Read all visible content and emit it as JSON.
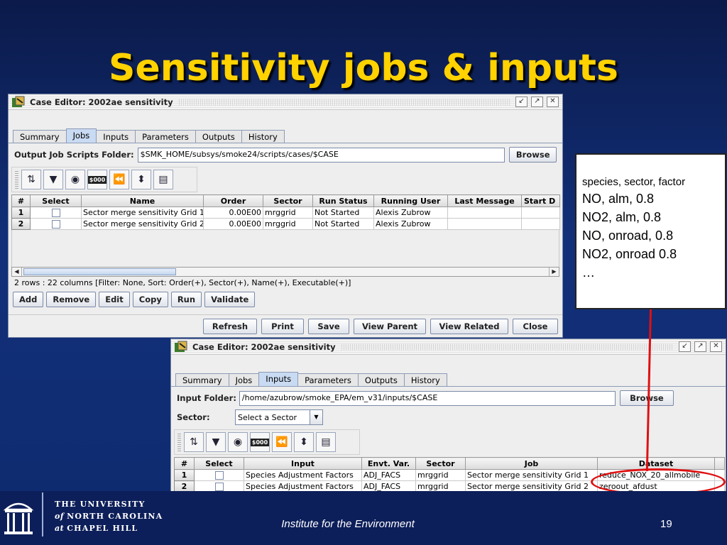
{
  "slide": {
    "title": "Sensitivity jobs & inputs",
    "footer_center": "Institute for the Environment",
    "page_number": "19",
    "logo": {
      "line1": "THE UNIVERSITY",
      "line2_of": "of",
      "line2": "NORTH CAROLINA",
      "line3_at": "at",
      "line3": "CHAPEL HILL"
    }
  },
  "jobs_window": {
    "title": "Case Editor: 2002ae sensitivity",
    "tabs": [
      "Summary",
      "Jobs",
      "Inputs",
      "Parameters",
      "Outputs",
      "History"
    ],
    "active_tab": "Jobs",
    "folder_label": "Output Job Scripts Folder:",
    "folder_value": "$SMK_HOME/subsys/smoke24/scripts/cases/$CASE",
    "browse_label": "Browse",
    "columns": [
      "#",
      "Select",
      "Name",
      "Order",
      "Sector",
      "Run Status",
      "Running User",
      "Last Message",
      "Start D"
    ],
    "rows": [
      {
        "num": "1",
        "name": "Sector merge sensitivity Grid 1",
        "order": "0.00E00",
        "sector": "mrggrid",
        "status": "Not Started",
        "user": "Alexis Zubrow"
      },
      {
        "num": "2",
        "name": "Sector merge sensitivity Grid 2",
        "order": "0.00E00",
        "sector": "mrggrid",
        "status": "Not Started",
        "user": "Alexis Zubrow"
      }
    ],
    "status_text": "2 rows : 22 columns [Filter: None, Sort: Order(+), Sector(+), Name(+), Executable(+)]",
    "action_buttons": [
      "Add",
      "Remove",
      "Edit",
      "Copy",
      "Run",
      "Validate"
    ],
    "bottom_buttons": [
      "Refresh",
      "Print",
      "Save",
      "View Parent",
      "View Related",
      "Close"
    ]
  },
  "inputs_window": {
    "title": "Case Editor: 2002ae sensitivity",
    "tabs": [
      "Summary",
      "Jobs",
      "Inputs",
      "Parameters",
      "Outputs",
      "History"
    ],
    "active_tab": "Inputs",
    "folder_label": "Input Folder:",
    "folder_value": "/home/azubrow/smoke_EPA/em_v31/inputs/$CASE",
    "browse_label": "Browse",
    "sector_label": "Sector:",
    "sector_selected": "Select a Sector",
    "columns": [
      "#",
      "Select",
      "Input",
      "Envt. Var.",
      "Sector",
      "Job",
      "Dataset"
    ],
    "rows": [
      {
        "num": "1",
        "input": "Species Adjustment Factors",
        "envt": "ADJ_FACS",
        "sector": "mrggrid",
        "job": "Sector merge sensitivity Grid 1",
        "dataset": "reduce_NOX_20_allmobile"
      },
      {
        "num": "2",
        "input": "Species Adjustment Factors",
        "envt": "ADJ_FACS",
        "sector": "mrggrid",
        "job": "Sector merge sensitivity Grid 2",
        "dataset": "zeroout_afdust"
      }
    ]
  },
  "callout": {
    "header": "species, sector, factor",
    "lines": [
      "NO, alm, 0.8",
      "NO2, alm, 0.8",
      "NO, onroad, 0.8",
      "NO2, onroad 0.8",
      "…"
    ]
  },
  "colors": {
    "title": "#ffd200",
    "background": "#12307a",
    "highlight": "#e01010"
  },
  "icons": [
    "app-icon",
    "minimize-icon",
    "maximize-icon",
    "close-icon",
    "sort-icon",
    "filter-icon",
    "eye-icon",
    "money-icon",
    "rewind-icon",
    "format-icon",
    "layout-icon",
    "dropdown-arrow-icon"
  ]
}
